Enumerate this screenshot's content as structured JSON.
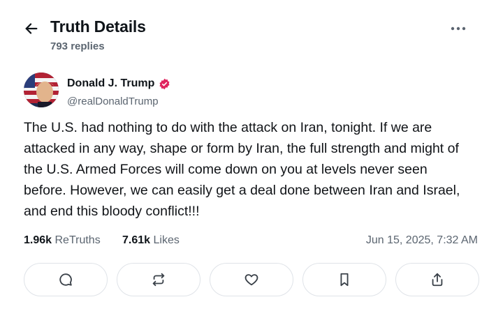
{
  "header": {
    "back_icon": "arrow-left-icon",
    "title": "Truth Details",
    "replies": "793 replies",
    "more_icon": "more-horizontal-icon"
  },
  "author": {
    "name": "Donald J. Trump",
    "handle": "@realDonaldTrump",
    "verified_icon": "verified-badge-icon",
    "verified_color": "#e0245e"
  },
  "post": {
    "text": "The U.S. had nothing to do with the attack on Iran, tonight. If we are attacked in any way, shape or form by Iran, the full strength and might of the U.S. Armed Forces will come down on you at levels never seen before. However, we can easily get a deal done between Iran and Israel, and end this bloody conflict!!!"
  },
  "stats": {
    "retruths_count": "1.96k",
    "retruths_label": "ReTruths",
    "likes_count": "7.61k",
    "likes_label": "Likes",
    "date": "Jun 15, 2025, 7:32 AM"
  },
  "actions": [
    {
      "name": "reply",
      "icon": "comment-icon"
    },
    {
      "name": "retruth",
      "icon": "repost-icon"
    },
    {
      "name": "like",
      "icon": "heart-icon"
    },
    {
      "name": "bookmark",
      "icon": "bookmark-icon"
    },
    {
      "name": "share",
      "icon": "share-icon"
    }
  ]
}
